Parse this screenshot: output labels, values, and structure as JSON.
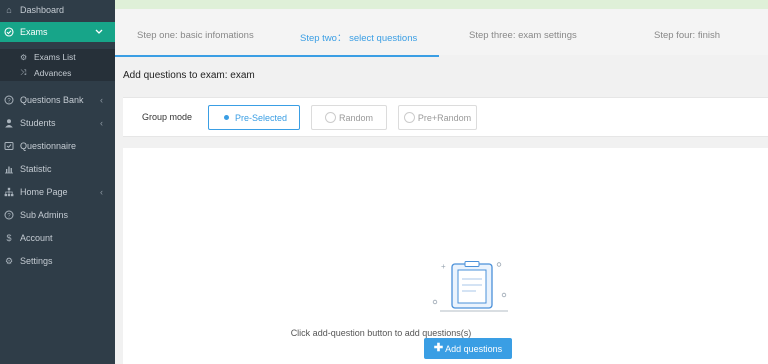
{
  "sidebar": {
    "items": [
      {
        "label": "Dashboard",
        "icon": "home-icon"
      },
      {
        "label": "Exams",
        "icon": "check-circle-icon",
        "active": true
      },
      {
        "label": "Questions Bank",
        "icon": "question-circle-icon"
      },
      {
        "label": "Students",
        "icon": "user-icon"
      },
      {
        "label": "Questionnaire",
        "icon": "questionnaire-icon"
      },
      {
        "label": "Statistic",
        "icon": "bar-chart-icon"
      },
      {
        "label": "Home Page",
        "icon": "sitemap-icon"
      },
      {
        "label": "Sub Admins",
        "icon": "question-circle-icon"
      },
      {
        "label": "Account",
        "icon": "dollar-icon"
      },
      {
        "label": "Settings",
        "icon": "gear-icon"
      }
    ],
    "exams_sub": [
      {
        "label": "Exams List",
        "icon": "gear-icon"
      },
      {
        "label": "Advances",
        "icon": "shuffle-icon"
      }
    ]
  },
  "steps": [
    {
      "label": "Step one: basic infomations"
    },
    {
      "label": "Step two： select questions"
    },
    {
      "label": "Step three: exam settings"
    },
    {
      "label": "Step four: finish"
    }
  ],
  "heading": "Add questions to exam: exam",
  "group": {
    "label": "Group mode",
    "modes": [
      "Pre-Selected",
      "Random",
      "Pre+Random"
    ],
    "selected": "Pre-Selected"
  },
  "empty": {
    "message": "Click add-question button to add questions(s)",
    "button_label": "Add questions"
  },
  "colors": {
    "sidebar_bg": "#2f3d48",
    "active_green": "#17a589",
    "accent_blue": "#3a9ee4"
  }
}
